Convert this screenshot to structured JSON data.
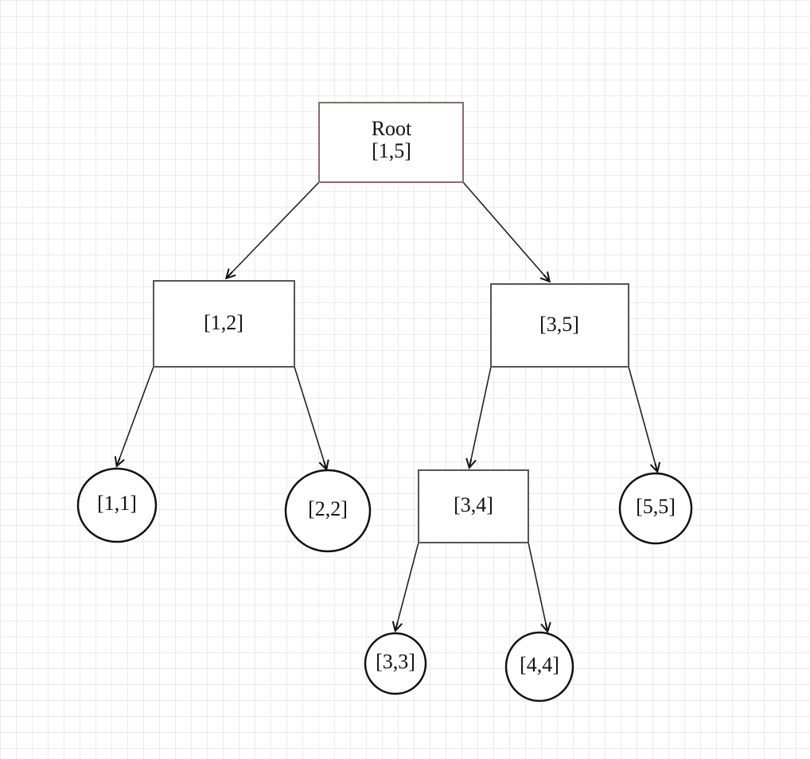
{
  "diagram": {
    "type": "segment-tree",
    "nodes": {
      "root": {
        "title": "Root",
        "range": "[1,5]"
      },
      "n12": {
        "range": "[1,2]"
      },
      "n35": {
        "range": "[3,5]"
      },
      "n11": {
        "range": "[1,1]"
      },
      "n22": {
        "range": "[2,2]"
      },
      "n34": {
        "range": "[3,4]"
      },
      "n55": {
        "range": "[5,5]"
      },
      "n33": {
        "range": "[3,3]"
      },
      "n44": {
        "range": "[4,4]"
      }
    },
    "edges": [
      [
        "root",
        "n12"
      ],
      [
        "root",
        "n35"
      ],
      [
        "n12",
        "n11"
      ],
      [
        "n12",
        "n22"
      ],
      [
        "n35",
        "n34"
      ],
      [
        "n35",
        "n55"
      ],
      [
        "n34",
        "n33"
      ],
      [
        "n34",
        "n44"
      ]
    ],
    "colors": {
      "root_border": "#8b6b6b",
      "node_border": "#555555",
      "leaf_border": "#111111",
      "grid": "#ebebeb"
    }
  }
}
